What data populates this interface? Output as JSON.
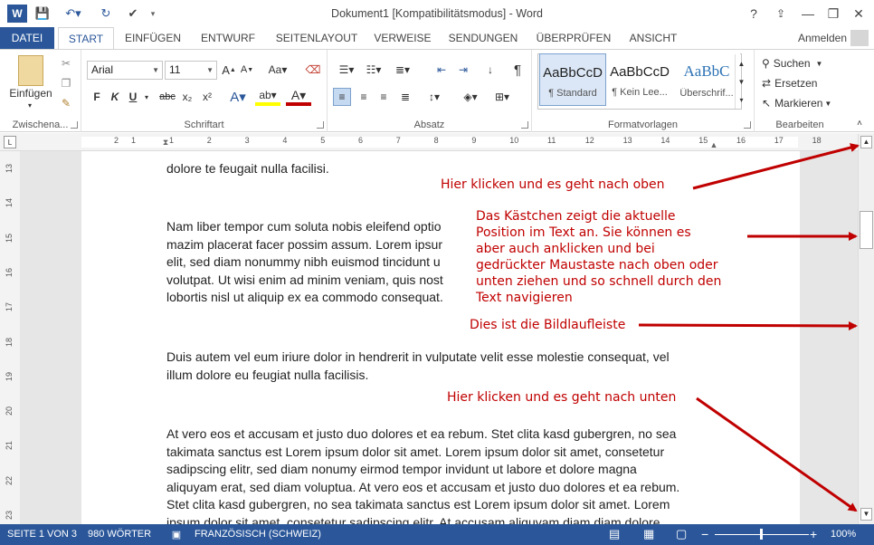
{
  "titlebar": {
    "title": "Dokument1 [Kompatibilitätsmodus] - Word",
    "help": "?",
    "minimize": "—",
    "close": "✕",
    "restore": "❐",
    "ribbon_options": "⇪"
  },
  "tabs": [
    "DATEI",
    "START",
    "EINFÜGEN",
    "ENTWURF",
    "SEITENLAYOUT",
    "VERWEISE",
    "SENDUNGEN",
    "ÜBERPRÜFEN",
    "ANSICHT"
  ],
  "account": "Anmelden",
  "ribbon": {
    "clipboard": {
      "label": "Zwischena...",
      "paste": "Einfügen"
    },
    "font": {
      "label": "Schriftart",
      "font_name": "Arial",
      "font_size": "11",
      "bold": "F",
      "italic": "K",
      "underline": "U",
      "strike": "abc",
      "sub": "x₂",
      "sup": "x²"
    },
    "paragraph": {
      "label": "Absatz"
    },
    "styles": {
      "label": "Formatvorlagen",
      "items": [
        {
          "preview": "AaBbCcD",
          "name": "¶ Standard"
        },
        {
          "preview": "AaBbCcD",
          "name": "¶ Kein Lee..."
        },
        {
          "preview": "AaBbC",
          "name": "Überschrif..."
        }
      ]
    },
    "editing": {
      "label": "Bearbeiten",
      "find": "Suchen",
      "replace": "Ersetzen",
      "select": "Markieren"
    }
  },
  "ruler_numbers": [
    "2",
    "1",
    "1",
    "2",
    "3",
    "4",
    "5",
    "6",
    "7",
    "8",
    "9",
    "10",
    "11",
    "12",
    "13",
    "14",
    "15",
    "16",
    "17",
    "18"
  ],
  "vruler_numbers": [
    "13",
    "14",
    "15",
    "16",
    "17",
    "18",
    "19",
    "20",
    "21",
    "22",
    "23"
  ],
  "document": {
    "paragraphs": [
      [
        "dolore te feugait nulla facilisi."
      ],
      [
        "Nam liber tempor cum soluta nobis eleifend optio",
        "mazim placerat facer possim assum. Lorem ipsur",
        "elit, sed diam nonummy nibh euismod tincidunt u",
        "volutpat. Ut wisi enim ad minim veniam, quis nost",
        "lobortis nisl ut aliquip ex ea commodo consequat."
      ],
      [
        "Duis autem vel eum iriure dolor in hendrerit in vulputate velit esse molestie consequat, vel",
        "illum dolore eu feugiat nulla facilisis."
      ],
      [
        "At vero eos et accusam et justo duo dolores et ea rebum. Stet clita kasd gubergren, no sea",
        "takimata sanctus est Lorem ipsum dolor sit amet. Lorem ipsum dolor sit amet, consetetur",
        "sadipscing elitr, sed diam nonumy eirmod tempor invidunt ut labore et dolore magna",
        "aliquyam erat, sed diam voluptua. At vero eos et accusam et justo duo dolores et ea rebum.",
        "Stet clita kasd gubergren, no sea takimata sanctus est Lorem ipsum dolor sit amet. Lorem",
        "ipsum dolor sit amet, consetetur sadipscing elitr. At accusam aliquyam diam diam dolore"
      ]
    ]
  },
  "annotations": {
    "top": "Hier klicken und es geht nach oben",
    "thumb": [
      "Das Kästchen zeigt die aktuelle",
      "Position im Text an. Sie können es",
      "aber auch anklicken und bei",
      "gedrückter Maustaste nach oben oder",
      "unten ziehen und so schnell durch den",
      "Text navigieren"
    ],
    "bar": "Dies ist die Bildlaufleiste",
    "bottom": "Hier klicken und es geht nach unten"
  },
  "statusbar": {
    "page": "SEITE 1 VON 3",
    "words": "980 WÖRTER",
    "language": "FRANZÖSISCH (SCHWEIZ)",
    "zoom": "100%",
    "zoom_minus": "−",
    "zoom_plus": "+"
  },
  "colors": {
    "accent": "#2b579a",
    "annotation": "#c00000"
  }
}
